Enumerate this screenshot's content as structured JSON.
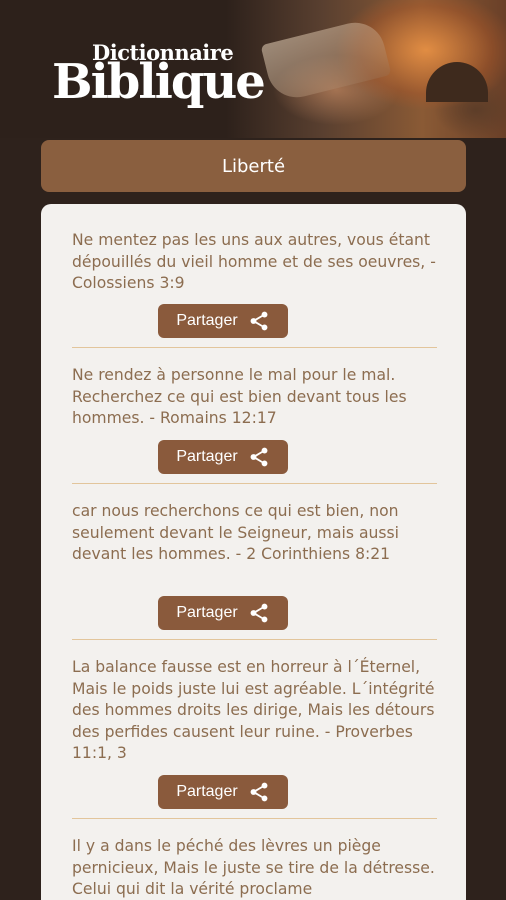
{
  "header": {
    "logo_small": "Dictionnaire",
    "logo_large": "Biblique"
  },
  "title": "Liberté",
  "verses": [
    {
      "text": "Ne mentez pas les uns aux autres, vous étant dépouillés du vieil homme et de ses oeuvres, - Colossiens 3:9",
      "share_label": "Partager",
      "share_icon": "share-icon"
    },
    {
      "text": "Ne rendez à personne le mal pour le mal. Recherchez ce qui est bien devant tous les hommes. - Romains 12:17",
      "share_label": "Partager",
      "share_icon": "share-icon"
    },
    {
      "text": "car nous recherchons ce qui est bien, non seulement devant le Seigneur, mais aussi devant les hommes. - 2 Corinthiens 8:21",
      "share_label": "Partager",
      "share_icon": "share-icon"
    },
    {
      "text": "La balance fausse est en horreur à l´Éternel, Mais le poids juste lui est agréable. L´intégrité des hommes droits les dirige, Mais les détours des perfides causent leur ruine. - Proverbes 11:1, 3",
      "share_label": "Partager",
      "share_icon": "share-icon"
    },
    {
      "text": "Il y a dans le péché des lèvres un piège pernicieux, Mais le juste se tire de la détresse. Celui qui dit la vérité proclame"
    }
  ],
  "colors": {
    "background": "#2e221c",
    "title_bar": "#8a5f3f",
    "button": "#8a5a3c",
    "verse_text": "#8c6d50",
    "divider": "#e2c59b",
    "card": "#f3f1ee"
  }
}
